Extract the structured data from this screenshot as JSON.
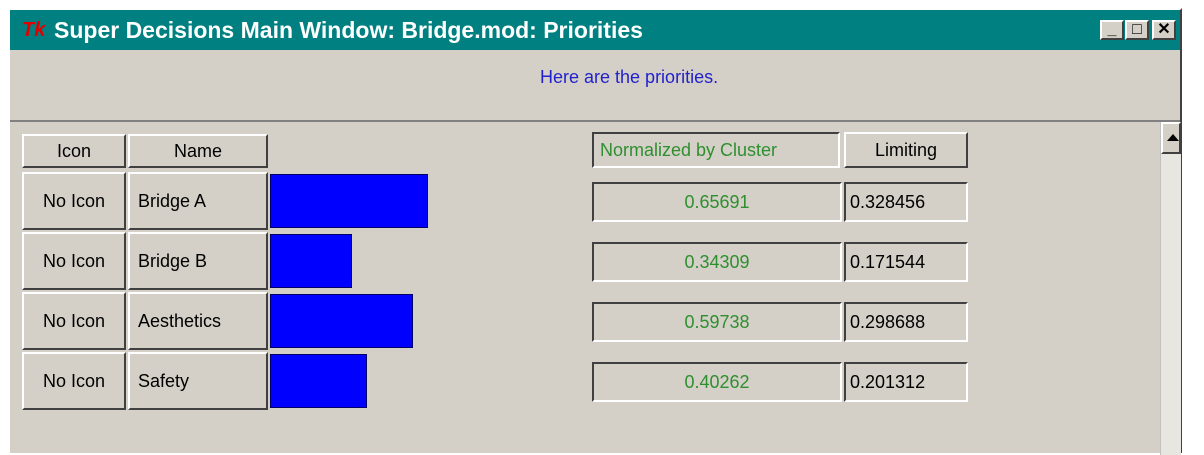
{
  "window": {
    "title": "Super Decisions Main Window: Bridge.mod: Priorities",
    "app_icon_text": "Tk",
    "buttons": {
      "minimize": "_",
      "maximize": "□",
      "close": "✕"
    }
  },
  "message": "Here are the priorities.",
  "headers": {
    "icon": "Icon",
    "name": "Name",
    "normalized": "Normalized by Cluster",
    "limiting": "Limiting"
  },
  "rows": [
    {
      "icon": "No Icon",
      "name": "Bridge A",
      "normalized": "0.65691",
      "limiting": "0.328456",
      "bar_fraction": 0.65691
    },
    {
      "icon": "No Icon",
      "name": "Bridge B",
      "normalized": "0.34309",
      "limiting": "0.171544",
      "bar_fraction": 0.34309
    },
    {
      "icon": "No Icon",
      "name": "Aesthetics",
      "normalized": "0.59738",
      "limiting": "0.298688",
      "bar_fraction": 0.59738
    },
    {
      "icon": "No Icon",
      "name": "Safety",
      "normalized": "0.40262",
      "limiting": "0.201312",
      "bar_fraction": 0.40262
    }
  ],
  "colors": {
    "bar": "#0000ff",
    "title_bar": "#008080",
    "value_text": "#2f8f2f",
    "message_text": "#2222cc"
  }
}
